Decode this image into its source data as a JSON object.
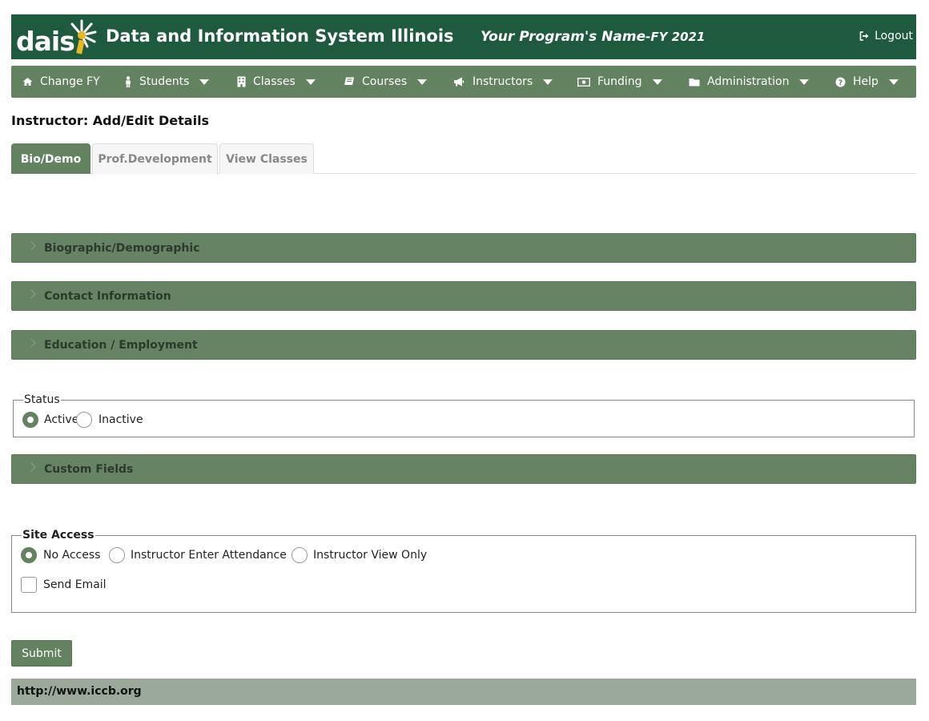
{
  "header": {
    "logo_text": "dais",
    "site_title": "Data and Information System Illinois",
    "program_name": "Your Program's Name",
    "program_fy": "-FY 2021",
    "logout_label": "Logout"
  },
  "nav": [
    {
      "label": "Change FY",
      "icon": "home-icon"
    },
    {
      "label": "Students",
      "icon": "person-icon"
    },
    {
      "label": "Classes",
      "icon": "building-icon"
    },
    {
      "label": "Courses",
      "icon": "book-icon"
    },
    {
      "label": "Instructors",
      "icon": "megaphone-icon"
    },
    {
      "label": "Funding",
      "icon": "money-icon"
    },
    {
      "label": "Administration",
      "icon": "folder-icon"
    },
    {
      "label": "Help",
      "icon": "question-circle-icon"
    }
  ],
  "page": {
    "title": "Instructor: Add/Edit Details"
  },
  "tabs": [
    {
      "label": "Bio/Demo",
      "active": true
    },
    {
      "label": "Prof.Development",
      "active": false
    },
    {
      "label": "View Classes",
      "active": false
    }
  ],
  "panels": {
    "biographic": "Biographic/Demographic",
    "contact": "Contact Information",
    "education": "Education / Employment",
    "custom": "Custom Fields"
  },
  "status": {
    "legend": "Status",
    "active_label": "Active",
    "inactive_label": "Inactive",
    "selected": "Active"
  },
  "site_access": {
    "legend": "Site Access",
    "options": [
      "No Access",
      "Instructor Enter Attendance",
      "Instructor View Only"
    ],
    "selected": "No Access",
    "send_email_label": "Send Email"
  },
  "submit_label": "Submit",
  "footer": {
    "link": "http://www.iccb.org"
  },
  "colors": {
    "header": "#1e5a3e",
    "nav": "#628260",
    "panel": "#668464",
    "footer": "#9aa99a"
  }
}
